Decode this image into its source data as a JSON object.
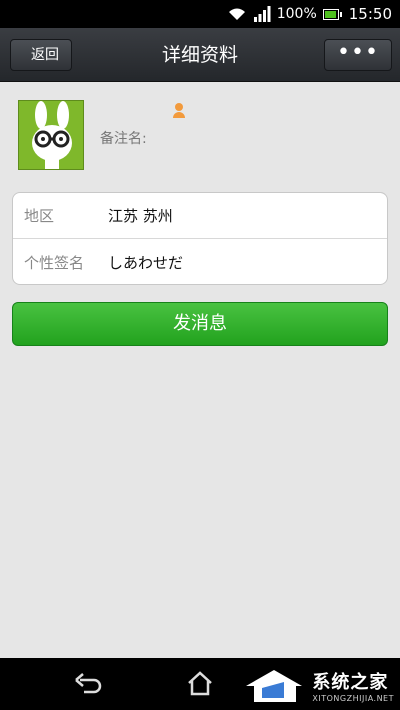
{
  "status_bar": {
    "battery": "100%",
    "battery_level": 1.0,
    "time": "15:50"
  },
  "header": {
    "title": "详细资料",
    "back_label": "返回",
    "more_label": "•••"
  },
  "profile": {
    "name": "",
    "remark_label": "备注名:",
    "remark_value": ""
  },
  "info": {
    "rows": [
      {
        "label": "地区",
        "value": "江苏  苏州"
      },
      {
        "label": "个性签名",
        "value": "しあわせだ"
      }
    ]
  },
  "actions": {
    "send_label": "发消息"
  },
  "watermark": {
    "title": "系统之家",
    "url": "XITONGZHIJIA.NET"
  },
  "colors": {
    "send_button": "#2bab2a",
    "avatar_bg": "#7fb82b",
    "gender_icon": "#f29a3c"
  }
}
